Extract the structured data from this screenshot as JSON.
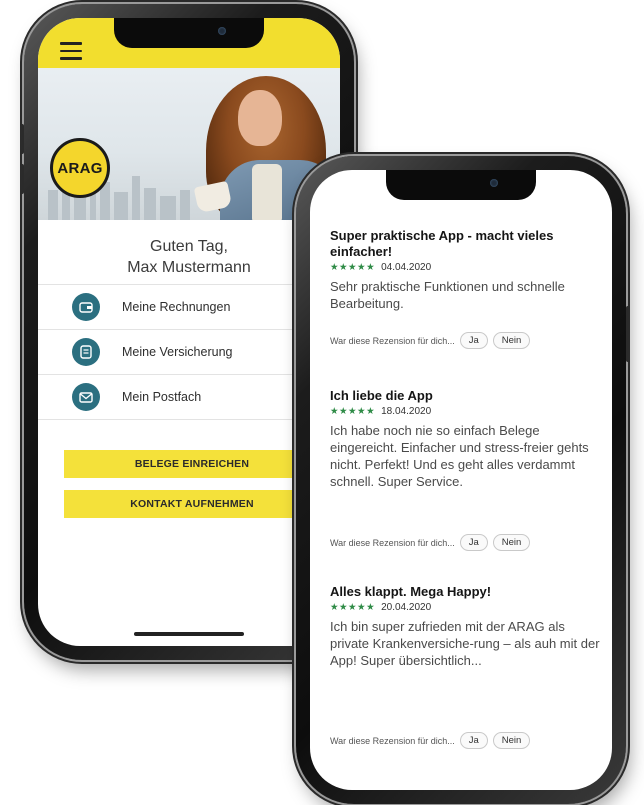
{
  "left_phone": {
    "logo_text": "ARAG",
    "greeting_line1": "Guten Tag,",
    "greeting_line2": "Max Mustermann",
    "menu": [
      {
        "label": "Meine Rechnungen",
        "icon": "wallet-icon"
      },
      {
        "label": "Meine Versicherung",
        "icon": "document-icon"
      },
      {
        "label": "Mein Postfach",
        "icon": "mail-icon"
      }
    ],
    "buttons": {
      "submit_receipts": "BELEGE EINREICHEN",
      "contact": "KONTAKT AUFNEHMEN"
    },
    "colors": {
      "brand_yellow": "#f2de2e",
      "icon_teal": "#2b6f80"
    }
  },
  "right_phone": {
    "reviews": [
      {
        "title": "Super praktische App - macht vieles einfacher!",
        "stars": "★★★★★",
        "date": "04.04.2020",
        "body": "Sehr praktische Funktionen und schnelle Bearbeitung.",
        "question": "War diese Rezension für dich...",
        "yes": "Ja",
        "no": "Nein"
      },
      {
        "title": "Ich liebe die App",
        "stars": "★★★★★",
        "date": "18.04.2020",
        "body": "Ich habe noch nie so einfach Belege eingereicht. Einfacher und stress-freier gehts nicht. Perfekt! Und es geht alles verdammt schnell. Super Service.",
        "question": "War diese Rezension für dich...",
        "yes": "Ja",
        "no": "Nein"
      },
      {
        "title": "Alles klappt. Mega Happy!",
        "stars": "★★★★★",
        "date": "20.04.2020",
        "body": "Ich bin super zufrieden mit der ARAG als private Krankenversiche-rung – als auh mit der App! Super übersichtlich...",
        "question": "War diese Rezension für dich...",
        "yes": "Ja",
        "no": "Nein"
      }
    ],
    "colors": {
      "star_green": "#2e8b46"
    }
  }
}
